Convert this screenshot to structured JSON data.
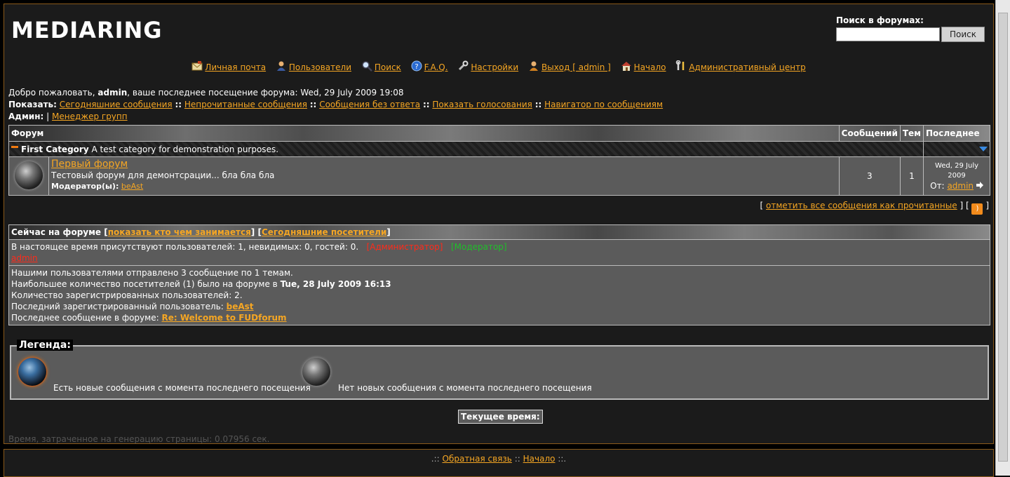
{
  "site": {
    "logo": "MEDIARING"
  },
  "search": {
    "label": "Поиск в форумах:",
    "button": "Поиск",
    "placeholder": ""
  },
  "nav": [
    {
      "label": "Личная почта",
      "icon": "mail-icon"
    },
    {
      "label": "Пользователи",
      "icon": "users-icon"
    },
    {
      "label": "Поиск",
      "icon": "search-icon"
    },
    {
      "label": "F.A.Q.",
      "icon": "help-icon"
    },
    {
      "label": "Настройки",
      "icon": "wrench-icon"
    },
    {
      "label": "Выход [ admin ]",
      "icon": "logout-icon"
    },
    {
      "label": "Начало",
      "icon": "home-icon"
    },
    {
      "label": "Административный центр",
      "icon": "admin-tools-icon"
    }
  ],
  "welcome": {
    "prefix": "Добро пожаловать,",
    "user": "admin",
    "suffix": ", ваше последнее посещение форума: Wed, 29 July 2009 19:08",
    "show_label": "Показать:",
    "show_links": [
      "Сегодняшние сообщения",
      "Непрочитанные сообщения",
      "Сообщения без ответа",
      "Показать голосования",
      "Навигатор по сообщениям"
    ],
    "show_sep": "::",
    "admin_label": "Админ:",
    "admin_sep": "|",
    "admin_link": "Менеджер групп"
  },
  "forum_table": {
    "columns": [
      "Форум",
      "Сообщений",
      "Тем",
      "Последнее"
    ],
    "category": {
      "name": "First Category",
      "description": "A test category for demonstration purposes."
    },
    "forums": [
      {
        "name": "Первый форум",
        "description": "Тестовый форум для демонтсрации... бла бла бла",
        "moderator_label": "Модератор(ы):",
        "moderator": "beAst",
        "posts": "3",
        "topics": "1",
        "last_date": "Wed, 29 July 2009",
        "last_by_label": "От:",
        "last_by": "admin"
      }
    ]
  },
  "mark_read": {
    "open": "[",
    "link": "отметить все сообщения как прочитанные",
    "mid": "] [",
    "close": "]"
  },
  "online": {
    "title": "Сейчас на форуме",
    "link1": "показать кто чем занимается",
    "link2": "Сегодняшние посетители",
    "presence_text": "В настоящее время присутствуют пользователей: 1, невидимых: 0, гостей: 0.",
    "role_admin": "[Администратор]",
    "role_moderator": "[Модератор]",
    "online_user": "admin",
    "stats": {
      "line1": "Нашими пользователями отправлено 3 сообщение по 1 темам.",
      "line2_prefix": "Наибольшее количество посетителей (1) было на форуме в",
      "line2_date": "Tue, 28 July 2009 16:13",
      "line3": "Количество зарегистрированных пользователей: 2.",
      "line4_prefix": "Последний зарегистрированный пользователь:",
      "line4_user": "beAst",
      "line5_prefix": "Последнее сообщение в форуме:",
      "line5_link": "Re: Welcome to FUDforum"
    }
  },
  "legend": {
    "title": "Легенда:",
    "new_text": "Есть новые сообщения с момента последнего посещения",
    "old_text": "Нет новых сообщения с момента последнего посещения"
  },
  "current_time_label": "Текущее время:",
  "generation": "Время, затраченное на генерацию страницы: 0.07956 сек.",
  "footer": {
    "open": ".::",
    "link1": "Обратная связь",
    "mid": "::",
    "link2": "Начало",
    "close": "::."
  },
  "colors": {
    "link": "#f5a623",
    "admin_role": "#ff2a1a",
    "moderator_role": "#1fbf2a",
    "border_accent": "#8a5a1a"
  }
}
